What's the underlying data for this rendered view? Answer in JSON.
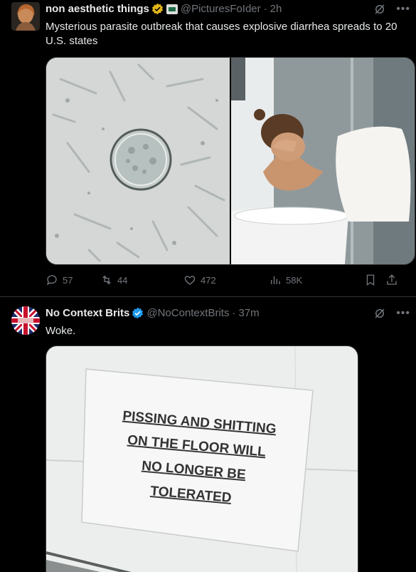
{
  "tweets": [
    {
      "display_name": "non aesthetic things",
      "handle": "@PicturesFoIder",
      "dot": "·",
      "time": "2h",
      "text": "Mysterious parasite outbreak that causes explosive diarrhea spreads to 20 U.S. states",
      "stats": {
        "replies": "57",
        "reposts": "44",
        "likes": "472",
        "views": "58K"
      },
      "verified_color": "#e2b719"
    },
    {
      "display_name": "No Context Brits",
      "handle": "@NoContextBrits",
      "dot": "·",
      "time": "37m",
      "text": "Woke.",
      "verified_color": "#1d9bf0",
      "sign_lines": [
        "PISSING AND SHITTING",
        "ON THE FLOOR WILL",
        "NO LONGER BE",
        "TOLERATED"
      ]
    }
  ],
  "colors": {
    "background": "#000000",
    "text": "#e7e9ea",
    "muted": "#71767b",
    "divider": "#2f3336"
  },
  "icons": [
    "verified-badge-icon",
    "affiliate-badge-icon",
    "grok-icon",
    "more-icon",
    "reply-icon",
    "repost-icon",
    "like-icon",
    "views-icon",
    "bookmark-icon",
    "share-icon"
  ]
}
